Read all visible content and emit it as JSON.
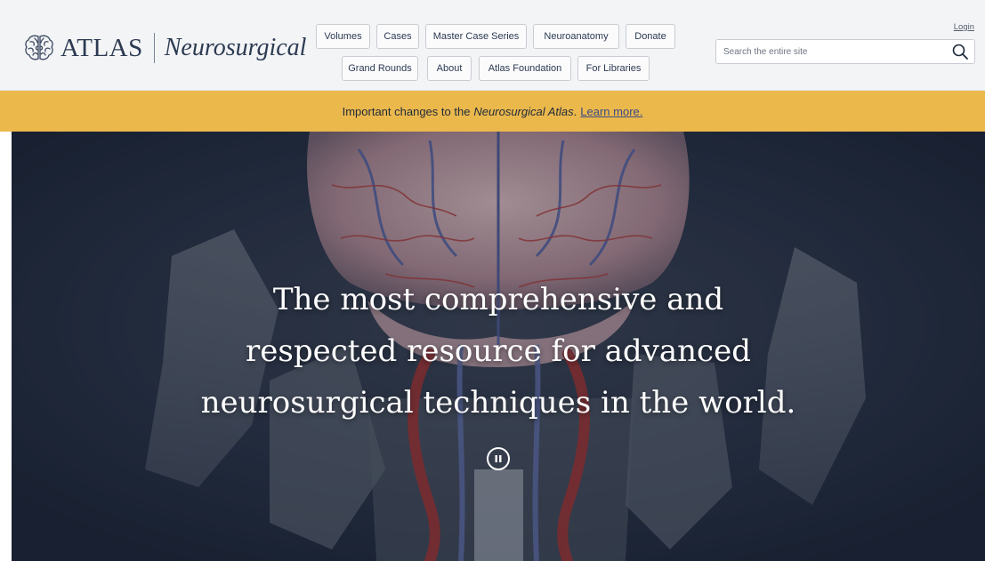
{
  "logo": {
    "atlas": "ATLAS",
    "neurosurgical": "Neurosurgical",
    "icon": "brain-icon"
  },
  "nav": {
    "row1": [
      "Volumes",
      "Cases",
      "Master Case Series",
      "Neuroanatomy",
      "Donate"
    ],
    "row2": [
      "Grand Rounds",
      "About",
      "Atlas Foundation",
      "For Libraries"
    ]
  },
  "login": "Login",
  "search": {
    "placeholder": "Search the entire site",
    "value": "",
    "icon": "search-icon"
  },
  "banner": {
    "prefix": "Important changes to the",
    "emphasis": "Neurosurgical Atlas",
    "period": ".",
    "link": "Learn more."
  },
  "hero": {
    "line1": "The most comprehensive and",
    "line2": "respected resource for advanced",
    "line3": "neurosurgical techniques in the world.",
    "pause_icon": "pause-icon"
  },
  "colors": {
    "header_bg": "#f3f4f6",
    "banner_bg": "#ebb84c",
    "hero_bg": "#1f2a3d",
    "brand_text": "#2c3a52"
  }
}
